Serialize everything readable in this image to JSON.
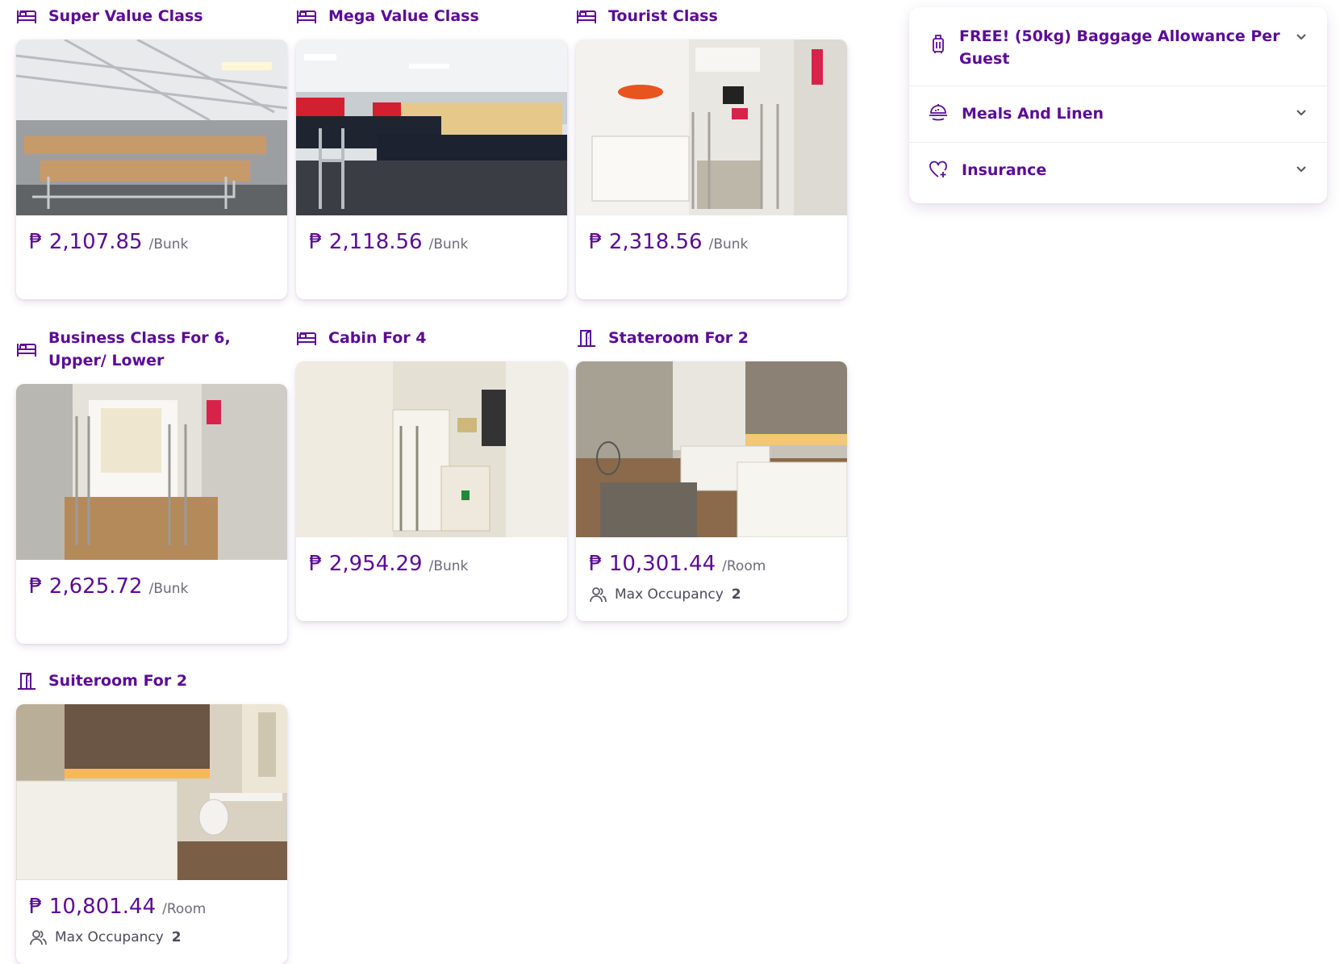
{
  "currency_symbol": "₱",
  "accent_color": "#5b0b97",
  "cards": [
    {
      "title": "Super Value Class",
      "icon": "bed-icon",
      "price": "2,107.85",
      "unit": "/Bunk"
    },
    {
      "title": "Mega Value Class",
      "icon": "bed-icon",
      "price": "2,118.56",
      "unit": "/Bunk"
    },
    {
      "title": "Tourist Class",
      "icon": "bed-icon",
      "price": "2,318.56",
      "unit": "/Bunk"
    },
    {
      "title": "Business Class For 6, Upper/ Lower",
      "icon": "bed-icon",
      "price": "2,625.72",
      "unit": "/Bunk"
    },
    {
      "title": "Cabin For 4",
      "icon": "bed-icon",
      "price": "2,954.29",
      "unit": "/Bunk"
    },
    {
      "title": "Stateroom For 2",
      "icon": "door-icon",
      "price": "10,301.44",
      "unit": "/Room",
      "occupancy_label": "Max Occupancy",
      "occupancy_value": "2"
    },
    {
      "title": "Suiteroom For 2",
      "icon": "door-icon",
      "price": "10,801.44",
      "unit": "/Room",
      "occupancy_label": "Max Occupancy",
      "occupancy_value": "2"
    }
  ],
  "accordion": [
    {
      "label": "FREE! (50kg) Baggage Allowance Per Guest",
      "icon": "luggage-icon"
    },
    {
      "label": "Meals And Linen",
      "icon": "meal-icon"
    },
    {
      "label": "Insurance",
      "icon": "heart-plus-icon"
    }
  ]
}
